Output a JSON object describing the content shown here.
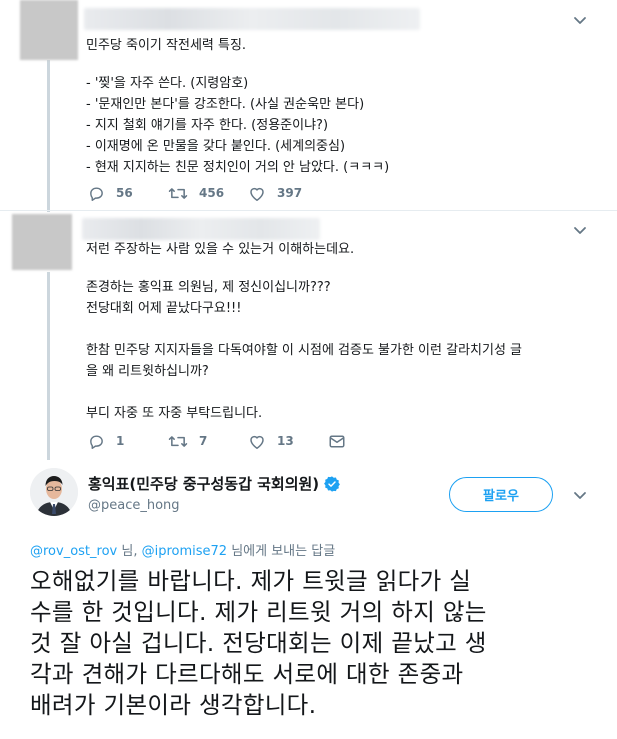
{
  "tweet1": {
    "lines": [
      "민주당 죽이기 작전세력 특징.",
      "",
      "- '찢'을 자주 쓴다. (지령암호)",
      "- '문재인만 본다'를 강조한다. (사실 권순욱만 본다)",
      "- 지지 철회 얘기를 자주 한다. (정용준이냐?)",
      "- 이재명에 온 만물을 갖다 붙인다. (세계의중심)",
      "- 현재 지지하는 친문 정치인이 거의 안 남았다. (ㅋㅋㅋ)"
    ],
    "reply_count": "56",
    "retweet_count": "456",
    "like_count": "397"
  },
  "tweet2": {
    "lines": [
      "저런 주장하는 사람 있을 수 있는거 이해하는데요.",
      "",
      "존경하는 홍익표 의원님, 제 정신이십니까???",
      "전당대회 어제 끝났다구요!!!",
      "",
      "한참 민주당 지지자들을 다독여야할 이 시점에 검증도 불가한 이런 갈라치기성 글",
      "을 왜 리트윗하십니까?",
      "",
      "부디 자중 또 자중 부탁드립니다."
    ],
    "reply_count": "1",
    "retweet_count": "7",
    "like_count": "13"
  },
  "main_tweet": {
    "display_name": "홍익표(민주당 중구성동갑 국회의원)",
    "handle": "@peace_hong",
    "follow_label": "팔로우",
    "reply_to": {
      "user1": "@rov_ost_rov",
      "sep": " 님, ",
      "user2": "@ipromise72",
      "suffix": " 님에게 보내는 답글"
    },
    "text_lines": [
      "오해없기를 바랍니다. 제가 트윗글 읽다가 실",
      "수를 한 것입니다. 제가 리트윗 거의 하지 않는",
      "것 잘 아실 겁니다. 전당대회는 이제 끝났고 생",
      "각과 견해가 다르다해도 서로에 대한 존중과",
      "배려가 기본이라 생각합니다."
    ]
  },
  "colors": {
    "accent": "#1da1f2",
    "muted": "#657786",
    "text": "#14171a",
    "thread_line": "#ccd6dd"
  },
  "icons": {
    "reply": "reply-icon",
    "retweet": "retweet-icon",
    "like": "heart-icon",
    "message": "message-icon",
    "caret": "chevron-down-icon",
    "verified": "verified-badge-icon"
  }
}
